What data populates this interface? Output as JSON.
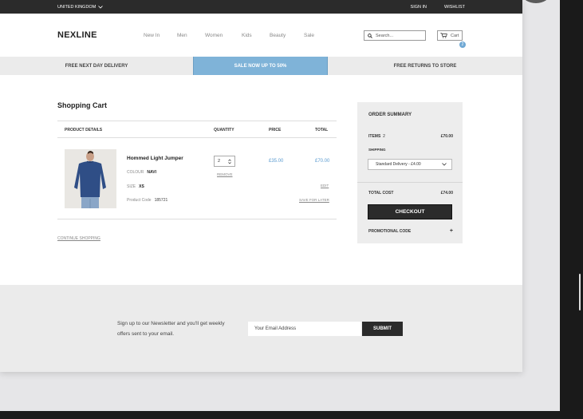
{
  "topbar": {
    "region": "UNITED KINGDOM",
    "sign_in": "SIGN IN",
    "wishlist": "WISHLIST"
  },
  "header": {
    "logo": "NEXLINE",
    "nav": [
      "New In",
      "Men",
      "Women",
      "Kids",
      "Beauty",
      "Sale"
    ],
    "search_placeholder": "Search...",
    "cart_label": "Cart",
    "cart_count": "2"
  },
  "promo": {
    "left": "FREE NEXT DAY DELIVERY",
    "center": "SALE NOW UP TO 50%",
    "right": "FREE RETURNS TO STORE"
  },
  "cart": {
    "title": "Shopping Cart",
    "columns": {
      "product": "PRODUCT DETAILS",
      "quantity": "QUANTITY",
      "price": "PRICE",
      "total": "TOTAL"
    },
    "item": {
      "name": "Hommed Light Jumper",
      "colour_label": "COLOUR",
      "colour": "NAVI",
      "size_label": "SIZE",
      "size": "XS",
      "code_label": "Product Code",
      "code": "185721",
      "quantity": "2",
      "remove": "REMOVE",
      "price": "£35.00",
      "total": "£70.00",
      "edit": "EDIT",
      "save_for_later": "SAVE FOR LATER"
    },
    "continue": "CONTINUE SHOPPING"
  },
  "summary": {
    "title": "ORDER SUMMARY",
    "items_label": "ITEMS",
    "items_count": "2",
    "items_total": "£70.00",
    "shipping_label": "SHIPPING",
    "shipping_option": "Standard Delivery - £4.00",
    "total_label": "TOTAL COST",
    "total": "£74.00",
    "checkout": "CHECKOUT",
    "promo_label": "PROMOTIONAL CODE",
    "promo_toggle": "+"
  },
  "newsletter": {
    "text": "Sign up to our Newsletter and you'll get weekly offers sent to your email.",
    "input_placeholder": "Your Email Address",
    "submit": "SUBMIT"
  },
  "colors": {
    "accent": "#7fb3d8",
    "price": "#5b9bd0",
    "dark": "#2b2b2b"
  }
}
